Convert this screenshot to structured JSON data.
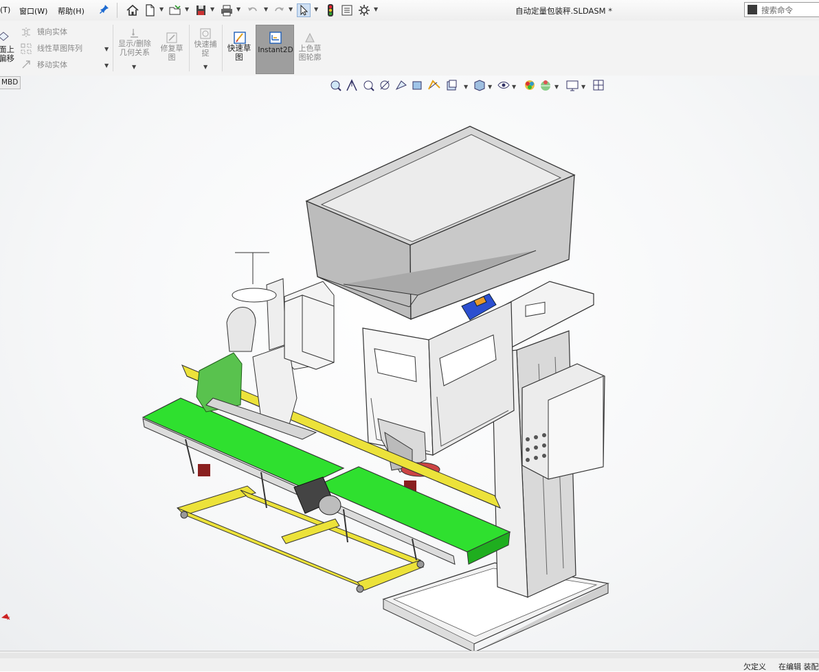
{
  "menu": {
    "tools_fragment": "(T)",
    "window": "窗口(W)",
    "help": "帮助(H)"
  },
  "document_title": "自动定量包装秤.SLDASM *",
  "search": {
    "placeholder": "搜索命令"
  },
  "command_manager": {
    "offset_surface": "面上偏移",
    "mirror_entities": "镜向实体",
    "linear_pattern": "线性草图阵列",
    "move_entities": "移动实体",
    "display_delete_relations": "显示/删除几何关系",
    "repair_sketch": "修复草图",
    "quick_snaps": "快速捕捉",
    "rapid_sketch": "快速草图",
    "instant2d": "Instant2D",
    "shaded_sketch_contours": "上色草图轮廓"
  },
  "tabs": {
    "mbd": "MBD"
  },
  "status_bar": {
    "defined": "欠定义",
    "editing": "在编辑 装配"
  },
  "icons": [
    "home-icon",
    "new-document-icon",
    "open-icon",
    "save-icon",
    "print-icon",
    "undo-icon",
    "redo-icon",
    "select-icon",
    "rebuild-icon",
    "file-properties-icon",
    "options-icon",
    "pin-icon",
    "zoom-to-fit-icon",
    "zoom-area-icon",
    "previous-view-icon",
    "section-view-icon",
    "view-orientation-icon",
    "display-style-icon",
    "hide-show-icon",
    "appearance-icon",
    "scene-icon",
    "view-settings-icon"
  ],
  "colors": {
    "belt_green": "#2fe02f",
    "frame_yellow": "#ece23a",
    "hopper_gray": "#b4b4b4",
    "motor_blue": "#2c4fd0",
    "instant2d_active": "#9e9e9e"
  }
}
